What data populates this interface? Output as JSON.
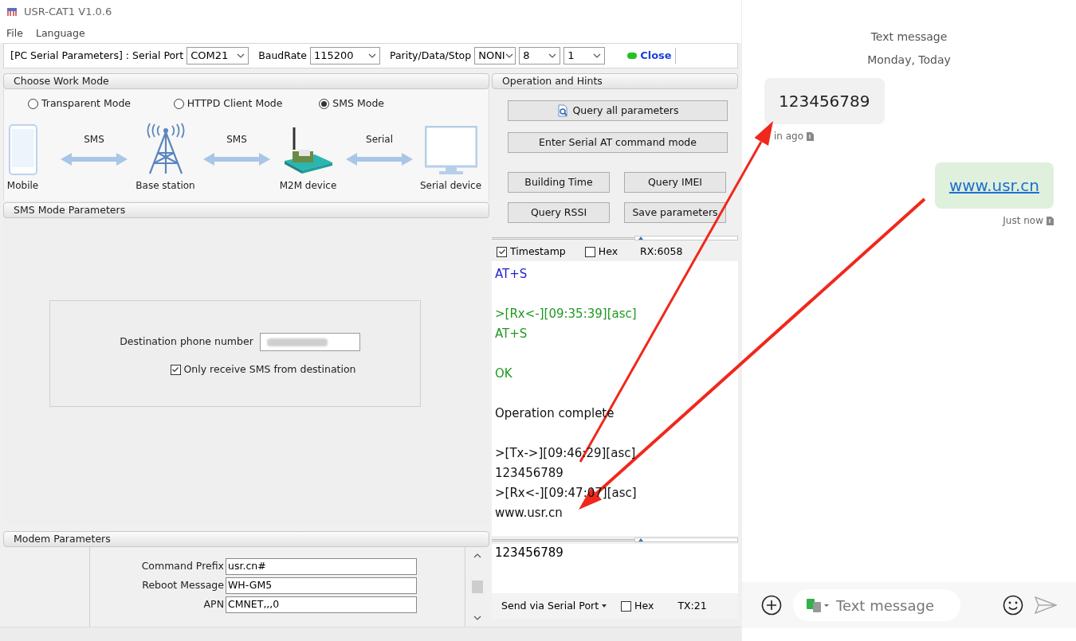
{
  "window": {
    "title": "USR-CAT1 V1.0.6"
  },
  "menu": [
    "File",
    "Language"
  ],
  "serial_bar": {
    "label": "[PC Serial Parameters] : Serial Port",
    "port": "COM21",
    "baud_label": "BaudRate",
    "baud": "115200",
    "pds_label": "Parity/Data/Stop",
    "parity": "NONI",
    "data": "8",
    "stop": "1",
    "connected": true,
    "close_button": "Close"
  },
  "work_mode": {
    "title": "Choose Work Mode",
    "modes": [
      {
        "label": "Transparent Mode",
        "selected": false
      },
      {
        "label": "HTTPD Client Mode",
        "selected": false
      },
      {
        "label": "SMS Mode",
        "selected": true
      }
    ],
    "diagram": {
      "nodes": [
        "Mobile",
        "Base station",
        "M2M device",
        "Serial device"
      ],
      "links": [
        "SMS",
        "SMS",
        "Serial"
      ]
    }
  },
  "sms_params": {
    "title": "SMS Mode Parameters",
    "destination_label": "Destination phone number",
    "only_receive": {
      "label": "Only receive SMS from destination",
      "checked": true
    }
  },
  "modem_params": {
    "title": "Modem Parameters",
    "fields": [
      {
        "label": "Command Prefix",
        "value": "usr.cn#"
      },
      {
        "label": "Reboot Message",
        "value": "WH-GM5"
      },
      {
        "label": "APN",
        "value": "CMNET,,,0"
      }
    ]
  },
  "operation": {
    "title": "Operation and Hints",
    "buttons": [
      "Query all parameters",
      "Enter Serial AT command mode",
      "Building Time",
      "Query IMEI",
      "Query RSSI",
      "Save parameters"
    ],
    "timestamp": {
      "label": "Timestamp",
      "checked": true
    },
    "hex": {
      "label": "Hex",
      "checked": false
    },
    "rx": "RX:6058",
    "log": [
      {
        "text": "AT+S",
        "kind": "sent",
        "space_before": false
      },
      {
        "text": ">[Rx<-][09:35:39][asc]",
        "kind": "received",
        "space_before": true
      },
      {
        "text": "AT+S",
        "kind": "received",
        "space_before": false
      },
      {
        "text": "OK",
        "kind": "received",
        "space_before": true
      },
      {
        "text": "Operation complete",
        "kind": "info",
        "space_before": true
      },
      {
        "text": ">[Tx->][09:46:29][asc]",
        "kind": "info",
        "space_before": true
      },
      {
        "text": "123456789",
        "kind": "info",
        "space_before": false
      },
      {
        "text": ">[Rx<-][09:47:07][asc]",
        "kind": "info",
        "space_before": false
      },
      {
        "text": "www.usr.cn",
        "kind": "info",
        "space_before": false
      }
    ],
    "input": "123456789",
    "send_mode": "Send via Serial Port",
    "send_hex": {
      "label": "Hex",
      "checked": false
    },
    "tx": "TX:21"
  },
  "phone": {
    "header": "Text message",
    "date": "Monday, Today",
    "messages": [
      {
        "text": "123456789",
        "kind": "incoming",
        "time": "in ago"
      },
      {
        "text": "www.usr.cn",
        "kind": "outgoing",
        "time": "Just now"
      }
    ],
    "compose_placeholder": "Text message"
  }
}
